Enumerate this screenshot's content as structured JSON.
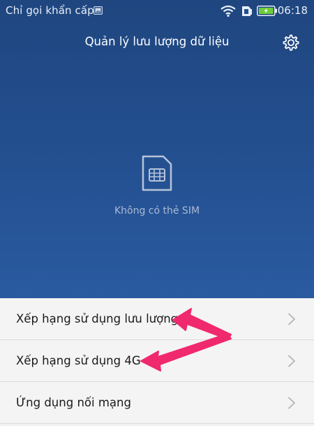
{
  "status_bar": {
    "carrier": "Chỉ gọi khẩn cấp",
    "time": "06:18",
    "icons": [
      "image-icon",
      "wifi-icon",
      "sim-status-icon",
      "battery-charging-icon"
    ]
  },
  "header": {
    "title": "Quản lý lưu lượng dữ liệu",
    "settings_icon": "gear-icon"
  },
  "main": {
    "sim_icon": "sim-card-icon",
    "no_sim_text": "Không có thẻ SIM"
  },
  "list": {
    "items": [
      {
        "label": "Xếp hạng sử dụng lưu lượng"
      },
      {
        "label": "Xếp hạng sử dụng 4G"
      },
      {
        "label": "Ứng dụng nối mạng"
      }
    ]
  },
  "annotations": {
    "arrows": [
      "pink-arrow-to-item-1",
      "pink-arrow-to-item-2"
    ]
  },
  "colors": {
    "header_bg": "#234f8f",
    "list_bg": "#f4f4f4",
    "arrow": "#f0286e",
    "battery": "#6ecb3a"
  }
}
